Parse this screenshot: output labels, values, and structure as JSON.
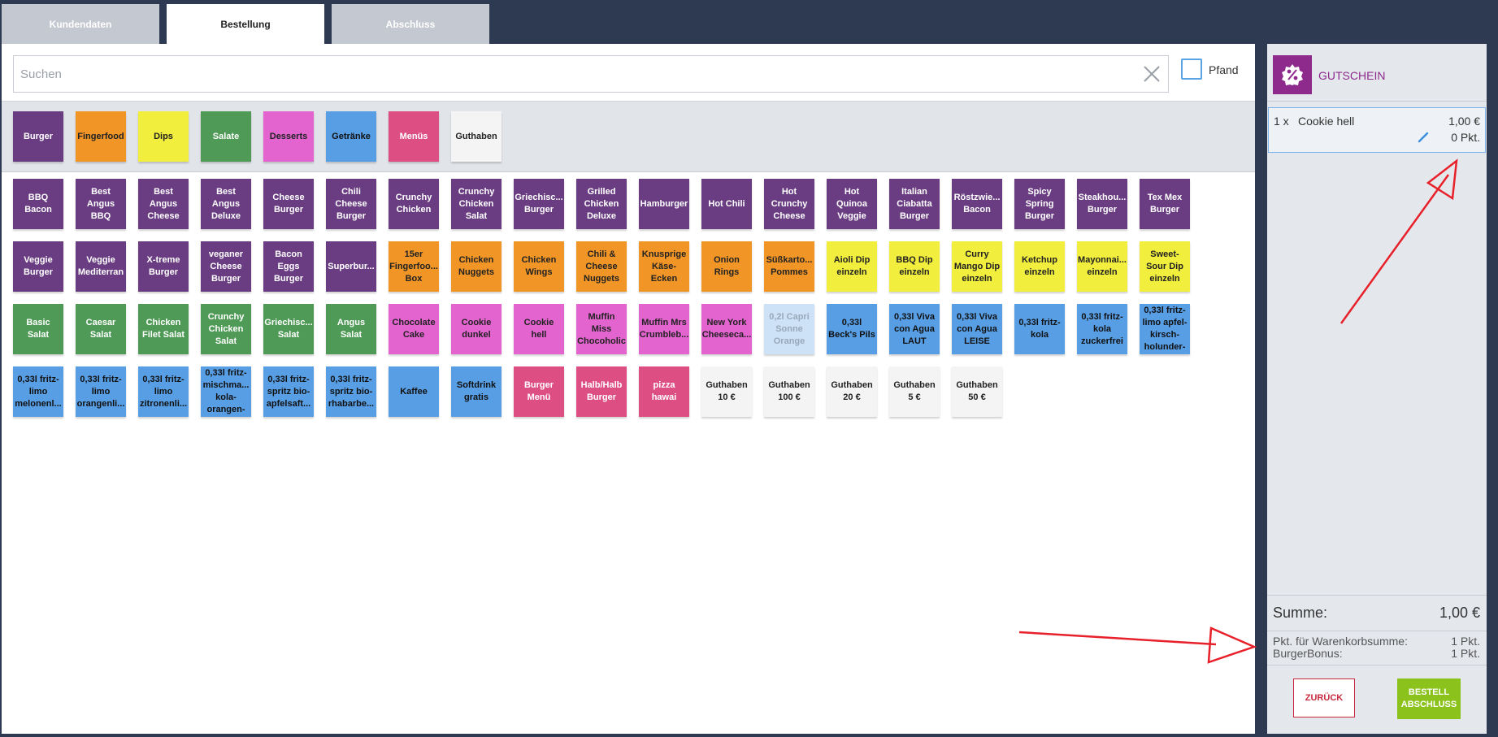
{
  "tabs": [
    {
      "label": "Kundendaten"
    },
    {
      "label": "Bestellung"
    },
    {
      "label": "Abschluss"
    }
  ],
  "search": {
    "placeholder": "Suchen",
    "value": ""
  },
  "pfand": {
    "label": "Pfand",
    "checked": false
  },
  "categories": [
    {
      "label": "Burger",
      "color": "#6a3d82"
    },
    {
      "label": "Fingerfood",
      "color": "#f09526"
    },
    {
      "label": "Dips",
      "color": "#f1ee3d"
    },
    {
      "label": "Salate",
      "color": "#4f9a56"
    },
    {
      "label": "Desserts",
      "color": "#e364cf"
    },
    {
      "label": "Getränke",
      "color": "#589ee4"
    },
    {
      "label": "Menüs",
      "color": "#dd4f83"
    },
    {
      "label": "Guthaben",
      "color": "#f4f4f4"
    }
  ],
  "products": [
    [
      {
        "label": "BBQ Bacon",
        "cat": "burger"
      },
      {
        "label": "Best Angus BBQ",
        "cat": "burger"
      },
      {
        "label": "Best Angus Cheese",
        "cat": "burger"
      },
      {
        "label": "Best Angus Deluxe",
        "cat": "burger"
      },
      {
        "label": "Cheese Burger",
        "cat": "burger"
      },
      {
        "label": "Chili Cheese Burger",
        "cat": "burger"
      },
      {
        "label": "Crunchy Chicken",
        "cat": "burger"
      },
      {
        "label": "Crunchy Chicken Salat",
        "cat": "burger"
      },
      {
        "label": "Griechisc... Burger",
        "cat": "burger"
      },
      {
        "label": "Grilled Chicken Deluxe",
        "cat": "burger"
      },
      {
        "label": "Hamburger",
        "cat": "burger"
      },
      {
        "label": "Hot Chili",
        "cat": "burger"
      },
      {
        "label": "Hot Crunchy Cheese",
        "cat": "burger"
      },
      {
        "label": "Hot Quinoa Veggie",
        "cat": "burger"
      },
      {
        "label": "Italian Ciabatta Burger",
        "cat": "burger"
      },
      {
        "label": "Röstzwie... Bacon",
        "cat": "burger"
      },
      {
        "label": "Spicy Spring Burger",
        "cat": "burger"
      },
      {
        "label": "Steakhou... Burger",
        "cat": "burger"
      },
      {
        "label": "Tex Mex Burger",
        "cat": "burger"
      }
    ],
    [
      {
        "label": "Veggie Burger",
        "cat": "burger"
      },
      {
        "label": "Veggie Mediterran",
        "cat": "burger"
      },
      {
        "label": "X-treme Burger",
        "cat": "burger"
      },
      {
        "label": "veganer Cheese Burger",
        "cat": "burger"
      },
      {
        "label": "Bacon Eggs Burger",
        "cat": "burger"
      },
      {
        "label": "Superbur...",
        "cat": "burger"
      },
      {
        "label": "15er Fingerfoo... Box",
        "cat": "finger"
      },
      {
        "label": "Chicken Nuggets",
        "cat": "finger"
      },
      {
        "label": "Chicken Wings",
        "cat": "finger"
      },
      {
        "label": "Chili & Cheese Nuggets",
        "cat": "finger"
      },
      {
        "label": "Knusprige Käse-Ecken",
        "cat": "finger"
      },
      {
        "label": "Onion Rings",
        "cat": "finger"
      },
      {
        "label": "Süßkarto... Pommes",
        "cat": "finger"
      },
      {
        "label": "Aioli Dip einzeln",
        "cat": "dips"
      },
      {
        "label": "BBQ Dip einzeln",
        "cat": "dips"
      },
      {
        "label": "Curry Mango Dip einzeln",
        "cat": "dips"
      },
      {
        "label": "Ketchup einzeln",
        "cat": "dips"
      },
      {
        "label": "Mayonnai... einzeln",
        "cat": "dips"
      },
      {
        "label": "Sweet-Sour Dip einzeln",
        "cat": "dips"
      }
    ],
    [
      {
        "label": "Basic Salat",
        "cat": "salat"
      },
      {
        "label": "Caesar Salat",
        "cat": "salat"
      },
      {
        "label": "Chicken Filet Salat",
        "cat": "salat"
      },
      {
        "label": "Crunchy Chicken Salat",
        "cat": "salat"
      },
      {
        "label": "Griechisc... Salat",
        "cat": "salat"
      },
      {
        "label": "Angus Salat",
        "cat": "salat"
      },
      {
        "label": "Chocolate Cake",
        "cat": "dessert"
      },
      {
        "label": "Cookie dunkel",
        "cat": "dessert"
      },
      {
        "label": "Cookie hell",
        "cat": "dessert"
      },
      {
        "label": "Muffin Miss Chocoholic",
        "cat": "dessert"
      },
      {
        "label": "Muffin Mrs Crumbleb...",
        "cat": "dessert"
      },
      {
        "label": "New York Cheeseca...",
        "cat": "dessert"
      },
      {
        "label": "0,2l Capri Sonne Orange",
        "cat": "disabled"
      },
      {
        "label": "0,33l Beck's Pils",
        "cat": "drink"
      },
      {
        "label": "0,33l Viva con Agua LAUT",
        "cat": "drink"
      },
      {
        "label": "0,33l Viva con Agua LEISE",
        "cat": "drink"
      },
      {
        "label": "0,33l fritz-kola",
        "cat": "drink"
      },
      {
        "label": "0,33l fritz-kola zuckerfrei",
        "cat": "drink"
      },
      {
        "label": "0,33l fritz-limo apfel-kirsch-holunder-",
        "cat": "drink"
      }
    ],
    [
      {
        "label": "0,33l fritz-limo melonenl...",
        "cat": "drink"
      },
      {
        "label": "0,33l fritz-limo orangenli...",
        "cat": "drink"
      },
      {
        "label": "0,33l fritz-limo zitronenli...",
        "cat": "drink"
      },
      {
        "label": "0,33l fritz-mischma... kola-orangen-",
        "cat": "drink"
      },
      {
        "label": "0,33l fritz-spritz bio-apfelsaft...",
        "cat": "drink"
      },
      {
        "label": "0,33l fritz-spritz bio-rhabarbe...",
        "cat": "drink"
      },
      {
        "label": "Kaffee",
        "cat": "drink"
      },
      {
        "label": "Softdrink gratis",
        "cat": "drink"
      },
      {
        "label": "Burger Menü",
        "cat": "menu"
      },
      {
        "label": "Halb/Halb Burger",
        "cat": "menu"
      },
      {
        "label": "pizza hawai",
        "cat": "menu"
      },
      {
        "label": "Guthaben 10 €",
        "cat": "guthaben"
      },
      {
        "label": "Guthaben 100 €",
        "cat": "guthaben"
      },
      {
        "label": "Guthaben 20 €",
        "cat": "guthaben"
      },
      {
        "label": "Guthaben 5 €",
        "cat": "guthaben"
      },
      {
        "label": "Guthaben 50 €",
        "cat": "guthaben"
      }
    ]
  ],
  "side": {
    "voucher_label": "GUTSCHEIN",
    "cart": [
      {
        "qty": "1 x",
        "name": "Cookie hell",
        "price": "1,00 €",
        "points": "0 Pkt."
      }
    ],
    "sum_label": "Summe:",
    "sum_value": "1,00 €",
    "points_label": "Pkt. für Warenkorbsumme:",
    "points_value": "1 Pkt.",
    "bonus_label": "BurgerBonus:",
    "bonus_value": "1 Pkt.",
    "back_label": "ZURÜCK",
    "finish_label": "BESTELL\nABSCHLUSS"
  },
  "colors": {
    "background": "#2e3a52",
    "accent_voucher": "#8d2a8c",
    "finish_green": "#8bc21c",
    "back_red": "#c8283d",
    "annotation_arrow": "#e8202a"
  }
}
